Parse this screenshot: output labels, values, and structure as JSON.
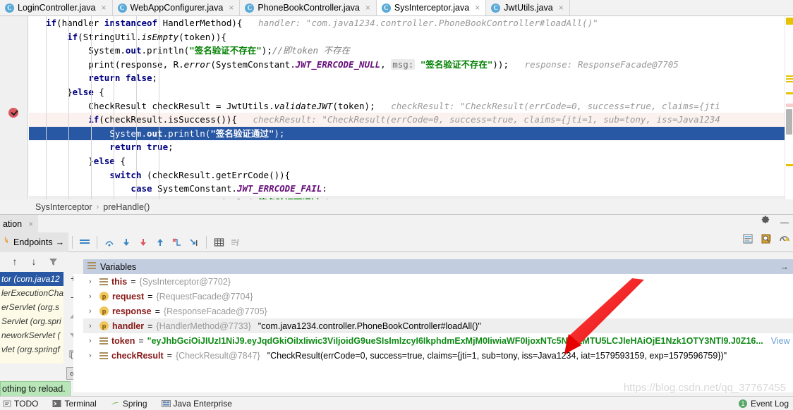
{
  "tabs": [
    {
      "label": "LoginController.java",
      "icon": "java-class-icon",
      "active": false,
      "close": "×"
    },
    {
      "label": "WebAppConfigurer.java",
      "icon": "java-class-icon",
      "active": false,
      "close": "×"
    },
    {
      "label": "PhoneBookController.java",
      "icon": "java-class-icon",
      "active": false,
      "close": "×"
    },
    {
      "label": "SysInterceptor.java",
      "icon": "java-class-icon",
      "active": true,
      "close": "×"
    },
    {
      "label": "JwtUtils.java",
      "icon": "java-class-icon",
      "active": false,
      "close": "×"
    }
  ],
  "editor": {
    "lines": [
      {
        "id": 1,
        "state": "normal",
        "segments": [
          {
            "t": "if",
            "c": "kw"
          },
          {
            "t": "(handler ",
            "c": "plain"
          },
          {
            "t": "instanceof",
            "c": "kw"
          },
          {
            "t": " HandlerMethod){",
            "c": "plain"
          },
          {
            "t": "   handler: \"com.java1234.controller.PhoneBookController#loadAll()\"",
            "c": "hint"
          }
        ]
      },
      {
        "id": 2,
        "state": "normal",
        "segments": [
          {
            "t": "    ",
            "c": "plain"
          },
          {
            "t": "if",
            "c": "kw"
          },
          {
            "t": "(StringUtil.",
            "c": "plain"
          },
          {
            "t": "isEmpty",
            "c": "mth"
          },
          {
            "t": "(token)){",
            "c": "plain"
          }
        ]
      },
      {
        "id": 3,
        "state": "normal",
        "segments": [
          {
            "t": "        System.",
            "c": "plain"
          },
          {
            "t": "out",
            "c": "kw"
          },
          {
            "t": ".println(",
            "c": "plain"
          },
          {
            "t": "\"签名验证不存在\"",
            "c": "str"
          },
          {
            "t": ");",
            "c": "plain"
          },
          {
            "t": "//即token 不存在",
            "c": "cmt"
          }
        ]
      },
      {
        "id": 4,
        "state": "normal",
        "segments": [
          {
            "t": "        print(response, R.",
            "c": "plain"
          },
          {
            "t": "error",
            "c": "mth"
          },
          {
            "t": "(SystemConstant.",
            "c": "plain"
          },
          {
            "t": "JWT_ERRCODE_NULL",
            "c": "const"
          },
          {
            "t": ", ",
            "c": "plain"
          },
          {
            "t": "msg:",
            "c": "hintbox"
          },
          {
            "t": " \"签名验证不存在\"",
            "c": "str"
          },
          {
            "t": "));",
            "c": "plain"
          },
          {
            "t": "   response: ResponseFacade@7705",
            "c": "hint"
          }
        ]
      },
      {
        "id": 5,
        "state": "normal",
        "segments": [
          {
            "t": "        ",
            "c": "plain"
          },
          {
            "t": "return false",
            "c": "kw"
          },
          {
            "t": ";",
            "c": "plain"
          }
        ]
      },
      {
        "id": 6,
        "state": "normal",
        "segments": [
          {
            "t": "    }",
            "c": "plain"
          },
          {
            "t": "else",
            "c": "kw"
          },
          {
            "t": " {",
            "c": "plain"
          }
        ]
      },
      {
        "id": 7,
        "state": "normal",
        "segments": [
          {
            "t": "        CheckResult checkResult = JwtUtils.",
            "c": "plain"
          },
          {
            "t": "validateJWT",
            "c": "mth"
          },
          {
            "t": "(token);",
            "c": "plain"
          },
          {
            "t": "   checkResult: \"CheckResult(errCode=0, success=true, claims={jti",
            "c": "hint"
          }
        ]
      },
      {
        "id": 8,
        "state": "warn",
        "segments": [
          {
            "t": "        ",
            "c": "plain"
          },
          {
            "t": "if",
            "c": "kw"
          },
          {
            "t": "(checkResult.isSuccess()){",
            "c": "plain"
          },
          {
            "t": "   checkResult: \"CheckResult(errCode=0, success=true, claims={jti=1, sub=tony, iss=Java1234",
            "c": "hint"
          }
        ]
      },
      {
        "id": 9,
        "state": "selected",
        "segments": [
          {
            "t": "            System.",
            "c": "plain"
          },
          {
            "t": "out",
            "c": "kw"
          },
          {
            "t": ".println(",
            "c": "plain"
          },
          {
            "t": "\"签名验证通过\"",
            "c": "str"
          },
          {
            "t": ");",
            "c": "plain"
          }
        ]
      },
      {
        "id": 10,
        "state": "normal",
        "segments": [
          {
            "t": "            ",
            "c": "plain"
          },
          {
            "t": "return true",
            "c": "kw"
          },
          {
            "t": ";",
            "c": "plain"
          }
        ]
      },
      {
        "id": 11,
        "state": "normal",
        "segments": [
          {
            "t": "        }",
            "c": "plain"
          },
          {
            "t": "else",
            "c": "kw"
          },
          {
            "t": " {",
            "c": "plain"
          }
        ]
      },
      {
        "id": 12,
        "state": "normal",
        "segments": [
          {
            "t": "            ",
            "c": "plain"
          },
          {
            "t": "switch",
            "c": "kw"
          },
          {
            "t": " (checkResult.getErrCode()){",
            "c": "plain"
          }
        ]
      },
      {
        "id": 13,
        "state": "normal",
        "segments": [
          {
            "t": "                ",
            "c": "plain"
          },
          {
            "t": "case",
            "c": "kw"
          },
          {
            "t": " SystemConstant.",
            "c": "plain"
          },
          {
            "t": "JWT_ERRCODE_FAIL",
            "c": "const"
          },
          {
            "t": ":",
            "c": "plain"
          }
        ]
      },
      {
        "id": 14,
        "state": "grey",
        "segments": [
          {
            "t": "                    System.",
            "c": "plain"
          },
          {
            "t": "out",
            "c": "kw"
          },
          {
            "t": ".println(",
            "c": "plain"
          },
          {
            "t": "\"签名验证不通过\"",
            "c": "str"
          },
          {
            "t": ");",
            "c": "plain"
          }
        ]
      }
    ]
  },
  "breadcrumb": {
    "class": "SysInterceptor",
    "separator": "›",
    "method": "preHandle()"
  },
  "debug_window": {
    "tab_label": "ation",
    "tab_close": "×",
    "gear_title": "settings-gear",
    "minimize_title": "hide"
  },
  "debug_toolbar": {
    "endpoints_label": "Endpoints",
    "endpoints_arrow": "→",
    "buttons": [
      {
        "name": "show-execution-point",
        "glyph": "☰"
      },
      {
        "name": "step-over",
        "glyph": "⤴"
      },
      {
        "name": "step-into",
        "glyph": "↓"
      },
      {
        "name": "force-step-into",
        "glyph": "↓"
      },
      {
        "name": "step-out",
        "glyph": "↑"
      },
      {
        "name": "drop-frame",
        "glyph": "↶"
      },
      {
        "name": "run-to-cursor",
        "glyph": "↘"
      },
      {
        "name": "evaluate-expression",
        "glyph": "▦"
      },
      {
        "name": "trace-current-stream-chain",
        "glyph": "≈"
      }
    ]
  },
  "frames": {
    "toolbar": [
      {
        "name": "frame-up",
        "glyph": "↑"
      },
      {
        "name": "frame-down",
        "glyph": "↓"
      },
      {
        "name": "filter-frames",
        "glyph": "▼"
      }
    ],
    "rows": [
      {
        "text": "tor (com.java12",
        "selected": true
      },
      {
        "text": "lerExecutionCha",
        "selected": false
      },
      {
        "text": "erServlet (org.s",
        "selected": false
      },
      {
        "text": "Servlet (org.spri",
        "selected": false
      },
      {
        "text": "neworkServlet (",
        "selected": false
      },
      {
        "text": "vlet (org.springf",
        "selected": false
      }
    ],
    "side_buttons": [
      {
        "name": "add-watch",
        "glyph": "+"
      },
      {
        "name": "remove-watch",
        "glyph": "−"
      },
      {
        "name": "move-up",
        "glyph": "▲"
      },
      {
        "name": "move-down",
        "glyph": "▼"
      },
      {
        "name": "copy-value",
        "glyph": "❐"
      },
      {
        "name": "inspect",
        "glyph": "∞"
      }
    ]
  },
  "variables": {
    "header_label": "Variables",
    "header_icon": "variables-icon",
    "expand_right": "→",
    "rows": [
      {
        "chevron": "›",
        "icon": "local-variable-icon",
        "name": "this",
        "eq": " = ",
        "ref": "{SysInterceptor@7702}",
        "value": "",
        "green": false,
        "view": "",
        "highlight": false
      },
      {
        "chevron": "›",
        "icon": "parameter-icon",
        "name": "request",
        "eq": " = ",
        "ref": "{RequestFacade@7704}",
        "value": "",
        "green": false,
        "view": "",
        "highlight": false
      },
      {
        "chevron": "›",
        "icon": "parameter-icon",
        "name": "response",
        "eq": " = ",
        "ref": "{ResponseFacade@7705}",
        "value": "",
        "green": false,
        "view": "",
        "highlight": false
      },
      {
        "chevron": "›",
        "icon": "parameter-icon",
        "name": "handler",
        "eq": " = ",
        "ref": "{HandlerMethod@7733}",
        "value": "\"com.java1234.controller.PhoneBookController#loadAll()\"",
        "green": false,
        "view": "",
        "highlight": true
      },
      {
        "chevron": "›",
        "icon": "local-variable-icon",
        "name": "token",
        "eq": " = ",
        "ref": "",
        "value": "\"eyJhbGciOiJIUzI1NiJ9.eyJqdGkiOiIxIiwic3ViIjoidG9ueSIsImlzcyI6IkphdmExMjM0IiwiaWF0IjoxNTc5NTkzMTU5LCJleHAiOjE1Nzk1OTY3NTl9.J0Z16...",
        "green": true,
        "view": "View",
        "highlight": false
      },
      {
        "chevron": "›",
        "icon": "local-variable-icon",
        "name": "checkResult",
        "eq": " = ",
        "ref": "{CheckResult@7847}",
        "value": "\"CheckResult(errCode=0, success=true, claims={jti=1, sub=tony, iss=Java1234, iat=1579593159, exp=1579596759})\"",
        "green": false,
        "view": "",
        "highlight": false
      }
    ]
  },
  "reload_tooltip": {
    "text": "othing to reload."
  },
  "statusbar": {
    "items": [
      {
        "label": "TODO",
        "icon": "todo-icon"
      },
      {
        "label": "Terminal",
        "icon": "terminal-icon"
      },
      {
        "label": "Spring",
        "icon": "spring-icon"
      },
      {
        "label": "Java Enterprise",
        "icon": "java-enterprise-icon"
      }
    ],
    "event_log": "Event Log",
    "event_count": "1"
  },
  "watermark": "https://blog.csdn.net/qq_37767455",
  "colors": {
    "selection_blue": "#2857a4",
    "warn_pink": "#fbf2f0",
    "variables_header": "#c2cde0",
    "frames_bg": "#fdfbe7",
    "string_green": "#008000",
    "keyword_navy": "#000080",
    "constant_purple": "#660e7a",
    "arrow_red": "#ee1111"
  }
}
